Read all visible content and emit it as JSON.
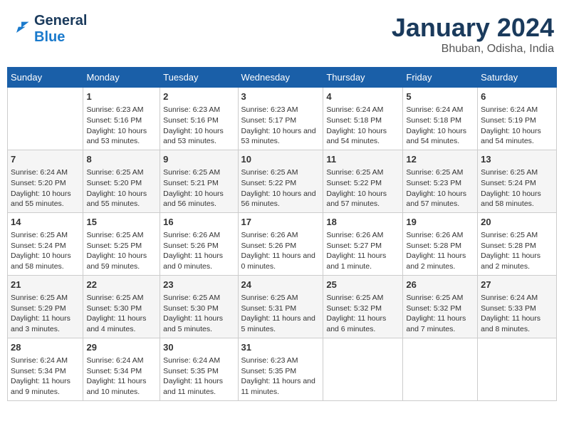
{
  "header": {
    "logo_line1": "General",
    "logo_line2": "Blue",
    "title": "January 2024",
    "location": "Bhuban, Odisha, India"
  },
  "columns": [
    "Sunday",
    "Monday",
    "Tuesday",
    "Wednesday",
    "Thursday",
    "Friday",
    "Saturday"
  ],
  "weeks": [
    [
      {
        "day": "",
        "info": ""
      },
      {
        "day": "1",
        "info": "Sunrise: 6:23 AM\nSunset: 5:16 PM\nDaylight: 10 hours and 53 minutes."
      },
      {
        "day": "2",
        "info": "Sunrise: 6:23 AM\nSunset: 5:16 PM\nDaylight: 10 hours and 53 minutes."
      },
      {
        "day": "3",
        "info": "Sunrise: 6:23 AM\nSunset: 5:17 PM\nDaylight: 10 hours and 53 minutes."
      },
      {
        "day": "4",
        "info": "Sunrise: 6:24 AM\nSunset: 5:18 PM\nDaylight: 10 hours and 54 minutes."
      },
      {
        "day": "5",
        "info": "Sunrise: 6:24 AM\nSunset: 5:18 PM\nDaylight: 10 hours and 54 minutes."
      },
      {
        "day": "6",
        "info": "Sunrise: 6:24 AM\nSunset: 5:19 PM\nDaylight: 10 hours and 54 minutes."
      }
    ],
    [
      {
        "day": "7",
        "info": "Sunrise: 6:24 AM\nSunset: 5:20 PM\nDaylight: 10 hours and 55 minutes."
      },
      {
        "day": "8",
        "info": "Sunrise: 6:25 AM\nSunset: 5:20 PM\nDaylight: 10 hours and 55 minutes."
      },
      {
        "day": "9",
        "info": "Sunrise: 6:25 AM\nSunset: 5:21 PM\nDaylight: 10 hours and 56 minutes."
      },
      {
        "day": "10",
        "info": "Sunrise: 6:25 AM\nSunset: 5:22 PM\nDaylight: 10 hours and 56 minutes."
      },
      {
        "day": "11",
        "info": "Sunrise: 6:25 AM\nSunset: 5:22 PM\nDaylight: 10 hours and 57 minutes."
      },
      {
        "day": "12",
        "info": "Sunrise: 6:25 AM\nSunset: 5:23 PM\nDaylight: 10 hours and 57 minutes."
      },
      {
        "day": "13",
        "info": "Sunrise: 6:25 AM\nSunset: 5:24 PM\nDaylight: 10 hours and 58 minutes."
      }
    ],
    [
      {
        "day": "14",
        "info": "Sunrise: 6:25 AM\nSunset: 5:24 PM\nDaylight: 10 hours and 58 minutes."
      },
      {
        "day": "15",
        "info": "Sunrise: 6:25 AM\nSunset: 5:25 PM\nDaylight: 10 hours and 59 minutes."
      },
      {
        "day": "16",
        "info": "Sunrise: 6:26 AM\nSunset: 5:26 PM\nDaylight: 11 hours and 0 minutes."
      },
      {
        "day": "17",
        "info": "Sunrise: 6:26 AM\nSunset: 5:26 PM\nDaylight: 11 hours and 0 minutes."
      },
      {
        "day": "18",
        "info": "Sunrise: 6:26 AM\nSunset: 5:27 PM\nDaylight: 11 hours and 1 minute."
      },
      {
        "day": "19",
        "info": "Sunrise: 6:26 AM\nSunset: 5:28 PM\nDaylight: 11 hours and 2 minutes."
      },
      {
        "day": "20",
        "info": "Sunrise: 6:25 AM\nSunset: 5:28 PM\nDaylight: 11 hours and 2 minutes."
      }
    ],
    [
      {
        "day": "21",
        "info": "Sunrise: 6:25 AM\nSunset: 5:29 PM\nDaylight: 11 hours and 3 minutes."
      },
      {
        "day": "22",
        "info": "Sunrise: 6:25 AM\nSunset: 5:30 PM\nDaylight: 11 hours and 4 minutes."
      },
      {
        "day": "23",
        "info": "Sunrise: 6:25 AM\nSunset: 5:30 PM\nDaylight: 11 hours and 5 minutes."
      },
      {
        "day": "24",
        "info": "Sunrise: 6:25 AM\nSunset: 5:31 PM\nDaylight: 11 hours and 5 minutes."
      },
      {
        "day": "25",
        "info": "Sunrise: 6:25 AM\nSunset: 5:32 PM\nDaylight: 11 hours and 6 minutes."
      },
      {
        "day": "26",
        "info": "Sunrise: 6:25 AM\nSunset: 5:32 PM\nDaylight: 11 hours and 7 minutes."
      },
      {
        "day": "27",
        "info": "Sunrise: 6:24 AM\nSunset: 5:33 PM\nDaylight: 11 hours and 8 minutes."
      }
    ],
    [
      {
        "day": "28",
        "info": "Sunrise: 6:24 AM\nSunset: 5:34 PM\nDaylight: 11 hours and 9 minutes."
      },
      {
        "day": "29",
        "info": "Sunrise: 6:24 AM\nSunset: 5:34 PM\nDaylight: 11 hours and 10 minutes."
      },
      {
        "day": "30",
        "info": "Sunrise: 6:24 AM\nSunset: 5:35 PM\nDaylight: 11 hours and 11 minutes."
      },
      {
        "day": "31",
        "info": "Sunrise: 6:23 AM\nSunset: 5:35 PM\nDaylight: 11 hours and 11 minutes."
      },
      {
        "day": "",
        "info": ""
      },
      {
        "day": "",
        "info": ""
      },
      {
        "day": "",
        "info": ""
      }
    ]
  ]
}
